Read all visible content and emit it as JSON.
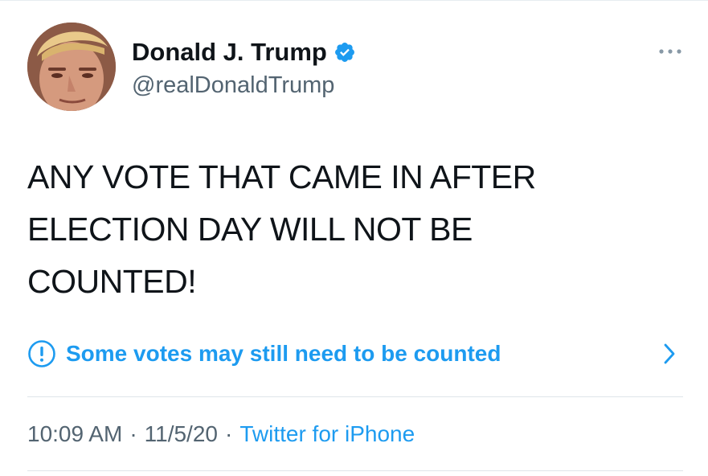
{
  "author": {
    "name": "Donald J. Trump",
    "handle": "@realDonaldTrump",
    "verified": true
  },
  "tweet": {
    "text_lines": [
      "ANY VOTE THAT CAME IN AFTER",
      "ELECTION DAY WILL NOT BE",
      "COUNTED!"
    ]
  },
  "notice": {
    "label": "Some votes may still need to be counted",
    "icon": "exclamation-circle-icon"
  },
  "meta": {
    "time": "10:09 AM",
    "date": "11/5/20",
    "separator": "·",
    "source": "Twitter for iPhone"
  },
  "colors": {
    "accent": "#1d9bf0",
    "text": "#0f1419",
    "muted": "#536471"
  }
}
